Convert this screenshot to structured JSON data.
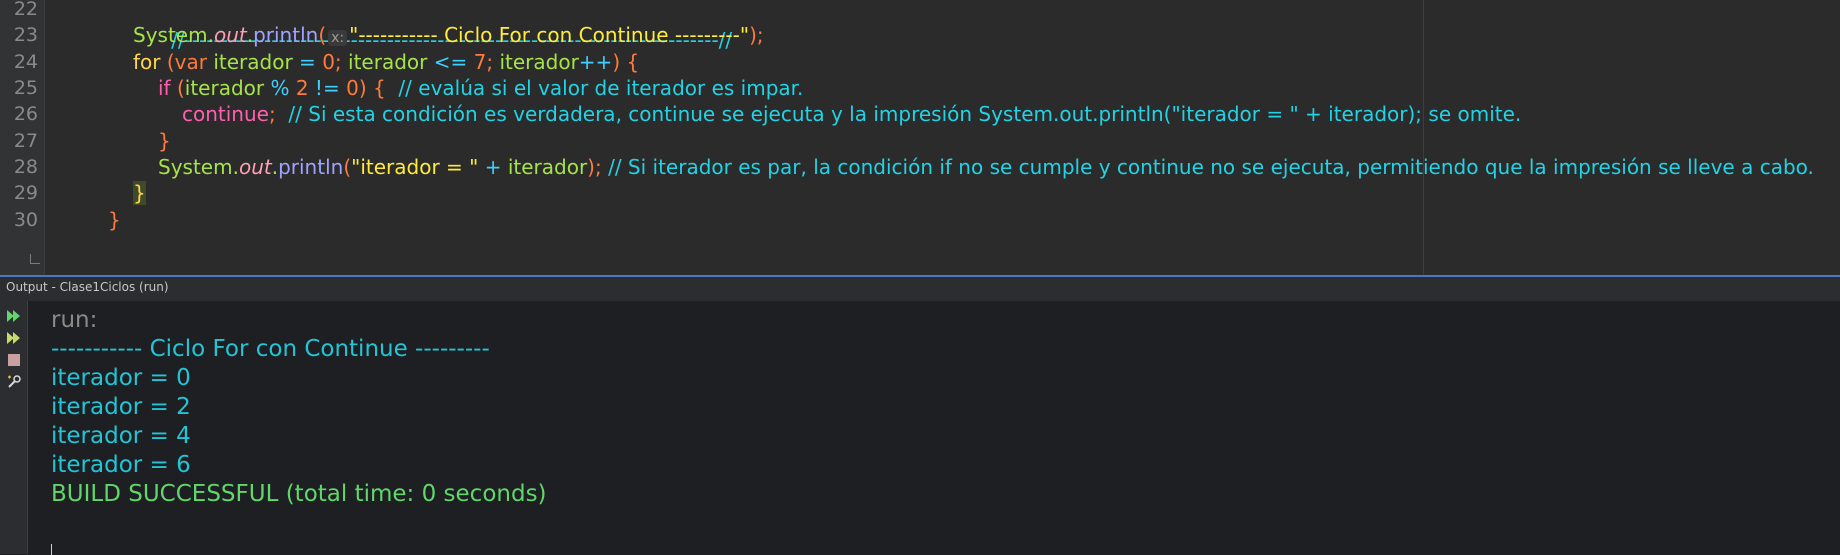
{
  "editor": {
    "line_numbers": [
      "22",
      "23",
      "24",
      "25",
      "26",
      "27",
      "28",
      "29",
      "30"
    ],
    "line22": {
      "comment": "//--------------------------------------------------------------------------//"
    },
    "line23": {
      "system": "System",
      "dot1": ".",
      "out": "out",
      "dot2": ".",
      "println": "println",
      "paren_open": "(",
      "hint": "x:",
      "string": "\"----------- Ciclo For con Continue ---------\"",
      "paren_close": ")",
      "semi": ";"
    },
    "line24": {
      "for": "for",
      "paren_open": " (",
      "var": "var",
      "iter1": " iterador",
      "eq": " = ",
      "zero": "0",
      "semi1": "; ",
      "iter2": "iterador",
      "le": " <= ",
      "seven": "7",
      "semi2": "; ",
      "iter3": "iterador",
      "inc": "++",
      "paren_close": ") ",
      "brace": "{"
    },
    "line25": {
      "if": "if",
      "paren_open": " (",
      "iter": "iterador",
      "mod": " % ",
      "two": "2",
      "ne": " != ",
      "zero": "0",
      "paren_close": ") ",
      "brace": "{",
      "comment": "  // evalúa si el valor de iterador es impar."
    },
    "line26": {
      "continue": "continue",
      "semi": ";",
      "comment": "  // Si esta condición es verdadera, continue se ejecuta y la impresión System.out.println(\"iterador = \" + iterador); se omite."
    },
    "line27": {
      "brace": "}"
    },
    "line28": {
      "system": "System",
      "dot1": ".",
      "out": "out",
      "dot2": ".",
      "println": "println",
      "paren_open": "(",
      "string": "\"iterador = \"",
      "plus": " + ",
      "iter": "iterador",
      "paren_close": ")",
      "semi": ";",
      "comment": " // Si iterador es par, la condición if no se cumple y continue no se ejecuta, permitiendo que la impresión se lleve a cabo."
    },
    "line29": {
      "brace": "}"
    },
    "line30": {
      "brace": "}"
    }
  },
  "output": {
    "title": "Output - Clase1Ciclos (run)",
    "lines": {
      "run": "run:",
      "header": "----------- Ciclo For con Continue ---------",
      "it0": "iterador = 0",
      "it2": "iterador = 2",
      "it4": "iterador = 4",
      "it6": "iterador = 6",
      "build": "BUILD SUCCESSFUL (total time: 0 seconds)"
    },
    "toolbar": {
      "rerun_icon": "rerun-icon",
      "rerun_params_icon": "rerun-with-params-icon",
      "stop_icon": "stop-icon",
      "settings_icon": "settings-icon"
    }
  }
}
